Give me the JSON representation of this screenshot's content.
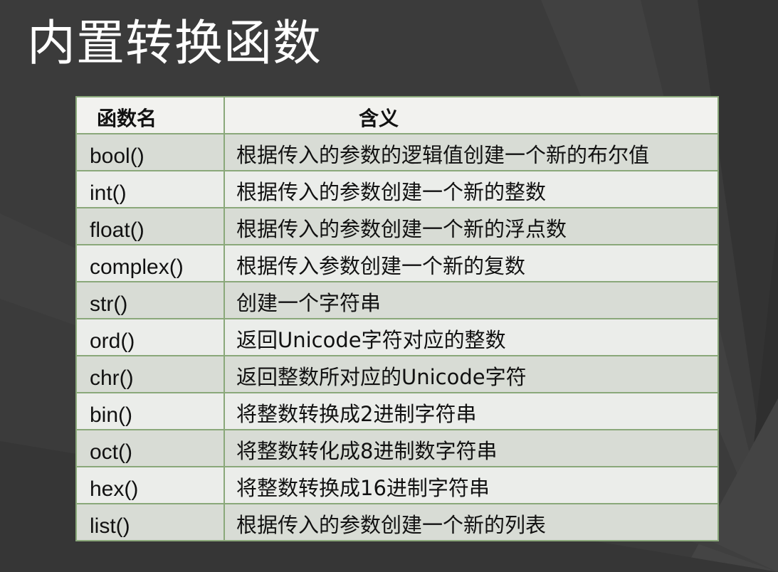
{
  "title": "内置转换函数",
  "table": {
    "headers": [
      "函数名",
      "含义"
    ],
    "rows": [
      {
        "name": "bool()",
        "desc": "根据传入的参数的逻辑值创建一个新的布尔值"
      },
      {
        "name": "int()",
        "desc": "根据传入的参数创建一个新的整数"
      },
      {
        "name": "float()",
        "desc": "根据传入的参数创建一个新的浮点数"
      },
      {
        "name": "complex()",
        "desc": "根据传入参数创建一个新的复数"
      },
      {
        "name": "str()",
        "desc": "创建一个字符串"
      },
      {
        "name": "ord()",
        "desc": "返回Unicode字符对应的整数"
      },
      {
        "name": "chr()",
        "desc": "返回整数所对应的Unicode字符"
      },
      {
        "name": "bin()",
        "desc": "将整数转换成2进制字符串"
      },
      {
        "name": "oct()",
        "desc": "将整数转化成8进制数字符串"
      },
      {
        "name": "hex()",
        "desc": "将整数转换成16进制字符串"
      },
      {
        "name": "list()",
        "desc": "根据传入的参数创建一个新的列表"
      }
    ]
  }
}
